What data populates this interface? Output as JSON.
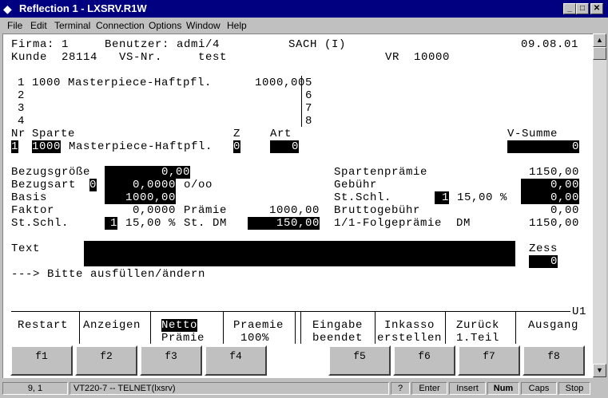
{
  "window": {
    "title": "Reflection 1 - LXSRV.R1W"
  },
  "menu": [
    "File",
    "Edit",
    "Terminal",
    "Connection",
    "Options",
    "Window",
    "Help"
  ],
  "screen": {
    "firma_line": "Firma: 1     Benutzer: admi/4",
    "mode": "SACH (I)",
    "date": "09.08.01",
    "kunde_line": "Kunde  28114   VS-Nr.     test",
    "vr_line": "VR  10000",
    "sparten_rows": [
      "1 1000 Masterpiece-Haftpfl.      1000,00",
      "2",
      "3",
      "4"
    ],
    "sparten_right": [
      "5",
      "6",
      "7",
      "8"
    ],
    "hdr_nr": "Nr",
    "hdr_sparte": "Sparte",
    "hdr_z": "Z",
    "hdr_art": "Art",
    "hdr_vsumme": "V-Summe",
    "row_nr": "1",
    "row_code": "1000",
    "row_name": "Masterpiece-Haftpfl.",
    "row_z": "0",
    "row_art": "0",
    "row_vsumme": "0",
    "bezugsgroesse_label": "Bezugsgröße",
    "bezugsgroesse_val": "0,00",
    "bezugsart_label": "Bezugsart",
    "bezugsart_code": "0",
    "bezugsart_val": "0,0000",
    "bezugsart_unit": "o/oo",
    "basis_label": "Basis",
    "basis_val": "1000,00",
    "faktor_label": "Faktor",
    "faktor_val": "0,0000",
    "praemie_label": "Prämie",
    "praemie_val": "1000,00",
    "stschl_label": "St.Schl.",
    "stschl_code": "1",
    "stschl_pct": "15,00 %",
    "stdm_label": "St. DM",
    "stdm_val": "150,00",
    "spartenpraemie_label": "Spartenprämie",
    "spartenpraemie_val": "1150,00",
    "gebuehr_label": "Gebühr",
    "gebuehr_val": "0,00",
    "r_stschl_label": "St.Schl.",
    "r_stschl_code": "1",
    "r_stschl_pct": "15,00 %",
    "r_stschl_val": "0,00",
    "bruttogebuehr_label": "Bruttogebühr",
    "bruttogebuehr_val": "0,00",
    "folgepraemie_label": "1/1-Folgeprämie  DM",
    "folgepraemie_val": "1150,00",
    "text_label": "Text",
    "zess_label": "Zess",
    "zess_val": "0",
    "prompt": "---> Bitte ausfüllen/ändern",
    "screen_id": "U1"
  },
  "softkeys": [
    {
      "l1": "Restart",
      "l2": ""
    },
    {
      "l1": "Anzeigen",
      "l2": ""
    },
    {
      "l1": "Netto",
      "l2": "Prämie"
    },
    {
      "l1": "Praemie",
      "l2": "100%"
    },
    {
      "l1": "Eingabe",
      "l2": "beendet"
    },
    {
      "l1": "Inkasso",
      "l2": "erstellen"
    },
    {
      "l1": "Zurück",
      "l2": "1.Teil"
    },
    {
      "l1": "Ausgang",
      "l2": ""
    }
  ],
  "fkeys": [
    "f1",
    "f2",
    "f3",
    "f4",
    "f5",
    "f6",
    "f7",
    "f8"
  ],
  "status": {
    "cursor": "9, 1",
    "session": "VT220-7 -- TELNET(lxsrv)",
    "help": "?",
    "enter": "Enter",
    "insert": "Insert",
    "num": "Num",
    "caps": "Caps",
    "stop": "Stop"
  }
}
